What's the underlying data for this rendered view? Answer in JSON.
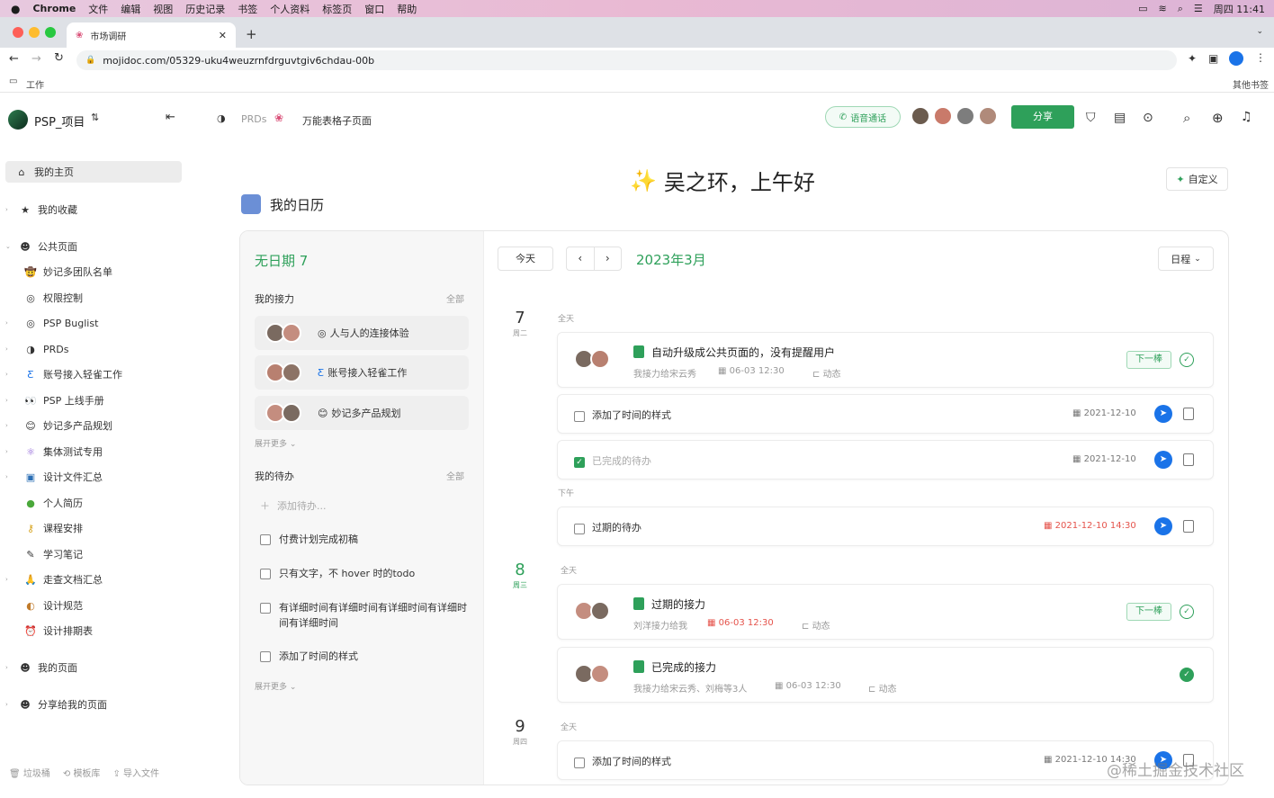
{
  "os": {
    "menu": [
      "Chrome",
      "文件",
      "编辑",
      "视图",
      "历史记录",
      "书签",
      "个人资料",
      "标签页",
      "窗口",
      "帮助"
    ],
    "clock": "周四 11:41"
  },
  "browser": {
    "tab_title": "市场调研",
    "url": "mojidoc.com/05329-uku4weuzrnfdrguvtgiv6chdau-00b",
    "bookmark_left": "工作",
    "bookmark_right": "其他书签"
  },
  "header": {
    "workspace": "PSP_项目",
    "breadcrumb": [
      "PRDs",
      "万能表格子页面"
    ],
    "voice_call": "语音通话",
    "share": "分享"
  },
  "sidebar": {
    "home": "我的主页",
    "favorites": "我的收藏",
    "public": "公共页面",
    "items": [
      "妙记多团队名单",
      "权限控制",
      "PSP Buglist",
      "PRDs",
      "账号接入轻雀工作",
      "PSP 上线手册",
      "妙记多产品规划",
      "集体测试专用",
      "设计文件汇总",
      "个人简历",
      "课程安排",
      "学习笔记",
      "走查文档汇总",
      "设计规范",
      "设计排期表"
    ],
    "my_pages": "我的页面",
    "shared": "分享给我的页面",
    "footer": [
      "垃圾桶",
      "模板库",
      "导入文件"
    ]
  },
  "main": {
    "greeting": "吴之环，上午好",
    "customize": "自定义",
    "calendar_title": "我的日历",
    "no_date": "无日期 7",
    "relay_title": "我的接力",
    "relay_all": "全部",
    "relays": [
      "人与人的连接体验",
      "账号接入轻雀工作",
      "妙记多产品规划"
    ],
    "expand_more": "展开更多",
    "todo_title": "我的待办",
    "todo_all": "全部",
    "add_todo": "添加待办...",
    "todos": [
      "付费计划完成初稿",
      "只有文字，不 hover 时的todo",
      "有详细时间有详细时间有详细时间有详细时间有详细时间",
      "添加了时间的样式"
    ],
    "today_btn": "今天",
    "month": "2023年3月",
    "view": "日程",
    "allday": "全天",
    "afternoon": "下午",
    "next_btn": "下一棒",
    "dynamic": "动态",
    "days": [
      {
        "num": "7",
        "week": "周二"
      },
      {
        "num": "8",
        "week": "周三"
      },
      {
        "num": "9",
        "week": "周四"
      }
    ],
    "events": [
      {
        "title": "自动升级成公共页面的，没有提醒用户",
        "who": "我接力给宋云秀",
        "time": "06-03 12:30"
      },
      {
        "title": "添加了时间的样式",
        "date": "2021-12-10"
      },
      {
        "title": "已完成的待办",
        "date": "2021-12-10"
      },
      {
        "title": "过期的待办",
        "date": "2021-12-10 14:30"
      },
      {
        "title": "过期的接力",
        "who": "刘洋接力给我",
        "time": "06-03 12:30"
      },
      {
        "title": "已完成的接力",
        "who": "我接力给宋云秀、刘梅等3人",
        "time": "06-03 12:30"
      },
      {
        "title": "添加了时间的样式",
        "date": "2021-12-10 14:30"
      }
    ],
    "watermark": "@稀土掘金技术社区"
  },
  "colors": {
    "accent": "#2ea05a",
    "danger": "#e5534b",
    "blue": "#1a73e8"
  }
}
